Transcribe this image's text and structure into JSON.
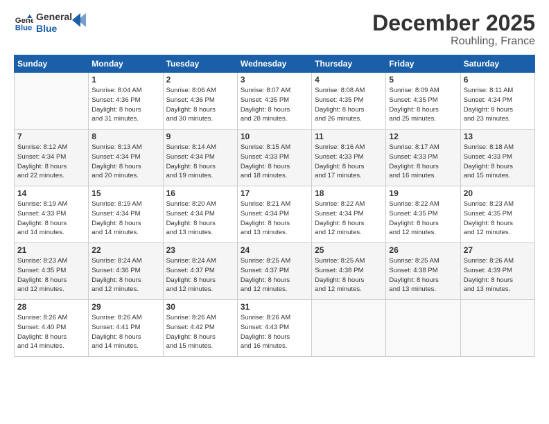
{
  "logo": {
    "line1": "General",
    "line2": "Blue"
  },
  "title": "December 2025",
  "location": "Rouhling, France",
  "headers": [
    "Sunday",
    "Monday",
    "Tuesday",
    "Wednesday",
    "Thursday",
    "Friday",
    "Saturday"
  ],
  "weeks": [
    [
      {
        "day": "",
        "info": ""
      },
      {
        "day": "1",
        "info": "Sunrise: 8:04 AM\nSunset: 4:36 PM\nDaylight: 8 hours\nand 31 minutes."
      },
      {
        "day": "2",
        "info": "Sunrise: 8:06 AM\nSunset: 4:36 PM\nDaylight: 8 hours\nand 30 minutes."
      },
      {
        "day": "3",
        "info": "Sunrise: 8:07 AM\nSunset: 4:35 PM\nDaylight: 8 hours\nand 28 minutes."
      },
      {
        "day": "4",
        "info": "Sunrise: 8:08 AM\nSunset: 4:35 PM\nDaylight: 8 hours\nand 26 minutes."
      },
      {
        "day": "5",
        "info": "Sunrise: 8:09 AM\nSunset: 4:35 PM\nDaylight: 8 hours\nand 25 minutes."
      },
      {
        "day": "6",
        "info": "Sunrise: 8:11 AM\nSunset: 4:34 PM\nDaylight: 8 hours\nand 23 minutes."
      }
    ],
    [
      {
        "day": "7",
        "info": "Sunrise: 8:12 AM\nSunset: 4:34 PM\nDaylight: 8 hours\nand 22 minutes."
      },
      {
        "day": "8",
        "info": "Sunrise: 8:13 AM\nSunset: 4:34 PM\nDaylight: 8 hours\nand 20 minutes."
      },
      {
        "day": "9",
        "info": "Sunrise: 8:14 AM\nSunset: 4:34 PM\nDaylight: 8 hours\nand 19 minutes."
      },
      {
        "day": "10",
        "info": "Sunrise: 8:15 AM\nSunset: 4:33 PM\nDaylight: 8 hours\nand 18 minutes."
      },
      {
        "day": "11",
        "info": "Sunrise: 8:16 AM\nSunset: 4:33 PM\nDaylight: 8 hours\nand 17 minutes."
      },
      {
        "day": "12",
        "info": "Sunrise: 8:17 AM\nSunset: 4:33 PM\nDaylight: 8 hours\nand 16 minutes."
      },
      {
        "day": "13",
        "info": "Sunrise: 8:18 AM\nSunset: 4:33 PM\nDaylight: 8 hours\nand 15 minutes."
      }
    ],
    [
      {
        "day": "14",
        "info": "Sunrise: 8:19 AM\nSunset: 4:33 PM\nDaylight: 8 hours\nand 14 minutes."
      },
      {
        "day": "15",
        "info": "Sunrise: 8:19 AM\nSunset: 4:34 PM\nDaylight: 8 hours\nand 14 minutes."
      },
      {
        "day": "16",
        "info": "Sunrise: 8:20 AM\nSunset: 4:34 PM\nDaylight: 8 hours\nand 13 minutes."
      },
      {
        "day": "17",
        "info": "Sunrise: 8:21 AM\nSunset: 4:34 PM\nDaylight: 8 hours\nand 13 minutes."
      },
      {
        "day": "18",
        "info": "Sunrise: 8:22 AM\nSunset: 4:34 PM\nDaylight: 8 hours\nand 12 minutes."
      },
      {
        "day": "19",
        "info": "Sunrise: 8:22 AM\nSunset: 4:35 PM\nDaylight: 8 hours\nand 12 minutes."
      },
      {
        "day": "20",
        "info": "Sunrise: 8:23 AM\nSunset: 4:35 PM\nDaylight: 8 hours\nand 12 minutes."
      }
    ],
    [
      {
        "day": "21",
        "info": "Sunrise: 8:23 AM\nSunset: 4:35 PM\nDaylight: 8 hours\nand 12 minutes."
      },
      {
        "day": "22",
        "info": "Sunrise: 8:24 AM\nSunset: 4:36 PM\nDaylight: 8 hours\nand 12 minutes."
      },
      {
        "day": "23",
        "info": "Sunrise: 8:24 AM\nSunset: 4:37 PM\nDaylight: 8 hours\nand 12 minutes."
      },
      {
        "day": "24",
        "info": "Sunrise: 8:25 AM\nSunset: 4:37 PM\nDaylight: 8 hours\nand 12 minutes."
      },
      {
        "day": "25",
        "info": "Sunrise: 8:25 AM\nSunset: 4:38 PM\nDaylight: 8 hours\nand 12 minutes."
      },
      {
        "day": "26",
        "info": "Sunrise: 8:25 AM\nSunset: 4:38 PM\nDaylight: 8 hours\nand 13 minutes."
      },
      {
        "day": "27",
        "info": "Sunrise: 8:26 AM\nSunset: 4:39 PM\nDaylight: 8 hours\nand 13 minutes."
      }
    ],
    [
      {
        "day": "28",
        "info": "Sunrise: 8:26 AM\nSunset: 4:40 PM\nDaylight: 8 hours\nand 14 minutes."
      },
      {
        "day": "29",
        "info": "Sunrise: 8:26 AM\nSunset: 4:41 PM\nDaylight: 8 hours\nand 14 minutes."
      },
      {
        "day": "30",
        "info": "Sunrise: 8:26 AM\nSunset: 4:42 PM\nDaylight: 8 hours\nand 15 minutes."
      },
      {
        "day": "31",
        "info": "Sunrise: 8:26 AM\nSunset: 4:43 PM\nDaylight: 8 hours\nand 16 minutes."
      },
      {
        "day": "",
        "info": ""
      },
      {
        "day": "",
        "info": ""
      },
      {
        "day": "",
        "info": ""
      }
    ]
  ]
}
